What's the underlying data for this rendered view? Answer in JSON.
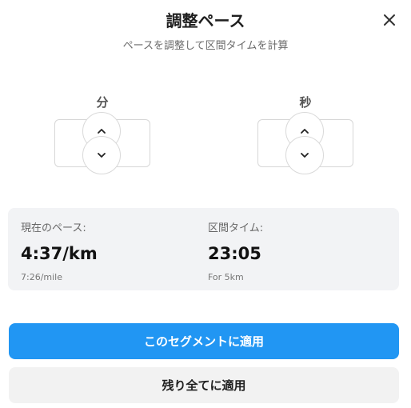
{
  "dialog": {
    "title": "調整ペース",
    "subtitle": "ペースを調整して区間タイムを計算",
    "close_icon": "close-icon"
  },
  "spinners": {
    "minutes": {
      "label": "分",
      "value": "",
      "up_icon": "chevron-up-icon",
      "down_icon": "chevron-down-icon"
    },
    "seconds": {
      "label": "秒",
      "value": "",
      "up_icon": "chevron-up-icon",
      "down_icon": "chevron-down-icon"
    }
  },
  "info": {
    "current_pace": {
      "label": "現在のペース:",
      "value": "4:37/km",
      "sub": "7:26/mile"
    },
    "split_time": {
      "label": "区間タイム:",
      "value": "23:05",
      "sub": "For 5km"
    }
  },
  "actions": {
    "apply_segment_label": "このセグメントに適用",
    "apply_all_label": "残り全てに適用"
  },
  "colors": {
    "primary": "#2196f3",
    "panel_bg": "#f2f3f5",
    "secondary_btn_bg": "#f2f2f2"
  }
}
